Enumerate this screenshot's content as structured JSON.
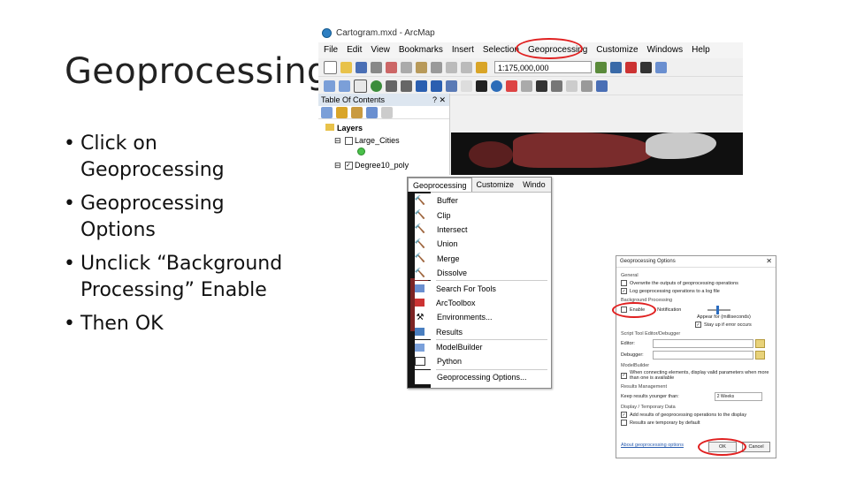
{
  "slide": {
    "title": "Geoprocessing",
    "bullets": [
      {
        "text": "Click on Geoprocessing"
      },
      {
        "text": "Geoprocessing Options"
      },
      {
        "text": "Unclick “Background Processing” Enable"
      },
      {
        "text": "Then OK"
      }
    ]
  },
  "arcmap": {
    "window_title": "Cartogram.mxd - ArcMap",
    "menus": [
      "File",
      "Edit",
      "View",
      "Bookmarks",
      "Insert",
      "Selection",
      "Geoprocessing",
      "Customize",
      "Windows",
      "Help"
    ],
    "scale": "1:175,000,000",
    "toc": {
      "title": "Table Of Contents",
      "controls": "? ✕",
      "layers_label": "Layers",
      "layer1": "Large_Cities",
      "layer2": "Degree10_poly"
    }
  },
  "geomenu": {
    "tabs": [
      "Geoprocessing",
      "Customize",
      "Windo"
    ],
    "items": [
      "Buffer",
      "Clip",
      "Intersect",
      "Union",
      "Merge",
      "Dissolve",
      "Search For Tools",
      "ArcToolbox",
      "Environments...",
      "Results",
      "ModelBuilder",
      "Python",
      "Geoprocessing Options..."
    ]
  },
  "dialog": {
    "title": "Geoprocessing Options",
    "general": "General",
    "overwrite": "Overwrite the outputs of geoprocessing operations",
    "log": "Log geoprocessing operations to a log file",
    "bg_section": "Background Processing",
    "enable": "Enable",
    "notification": "Notification",
    "appear_for": "Appear for (milliseconds)",
    "stay_up": "Stay up if error occurs",
    "script_section": "Script Tool Editor/Debugger",
    "editor": "Editor:",
    "debugger": "Debugger:",
    "modelbuilder_section": "ModelBuilder",
    "modelbuilder_opt": "When connecting elements, display valid parameters when more than one is available",
    "results_section": "Results Management",
    "keep_results": "Keep results younger than:",
    "keep_value": "2 Weeks",
    "display_section": "Display / Temporary Data",
    "add_results": "Add results of geoprocessing operations to the display",
    "temporary": "Results are temporary by default",
    "about_link": "About geoprocessing options",
    "ok": "OK",
    "cancel": "Cancel"
  }
}
